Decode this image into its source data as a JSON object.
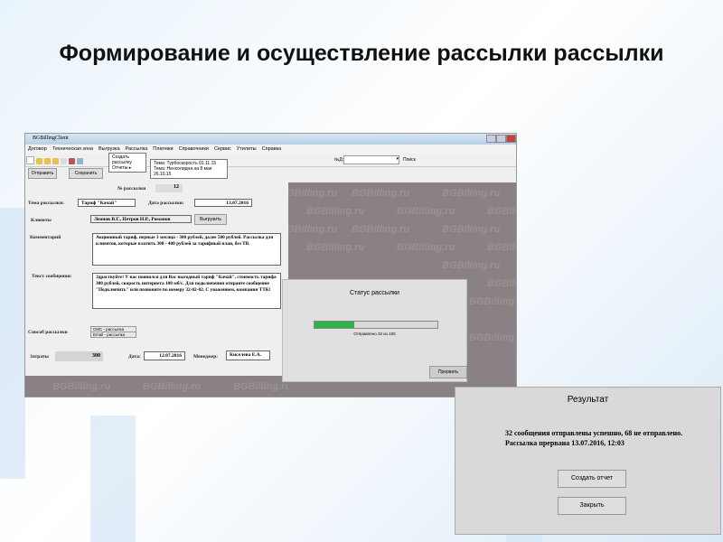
{
  "slide_title": "Формирование и осуществление рассылки рассылки",
  "window": {
    "title": "BGBillingClient",
    "menu": [
      "Договор",
      "Техническая зона",
      "Выгрузка",
      "Рассылка",
      "Платежи",
      "Справочники",
      "Сервис",
      "Утилиты",
      "Справка"
    ],
    "submenu": [
      "Создать рассылку",
      "Отчеты"
    ],
    "reports": [
      "Тема: Турбоскорость 01.11.15",
      "Тема: Ненсолидна на 8 мая 26.10.15"
    ],
    "nd_label": "№Д:",
    "search_label": "Поиск",
    "buttons": {
      "send": "Отправить",
      "save": "Сохранить",
      "export": "Выгрузить"
    }
  },
  "form": {
    "number_label": "№ рассылки",
    "number": "12",
    "subject_label": "Тема рассылки:",
    "subject": "Тариф \"Качай\"",
    "date_label": "Дата рассылки:",
    "date": "13.07.2016",
    "clients_label": "Клиенты",
    "clients": "Леонов В.Г., Петров Н.Р., Романов",
    "comment_label": "Комментарий",
    "comment": "Акционный тариф, первые 3 месяца - 300 рублей, далее 500 рублей. Рассылка для клиентов, которые платить 300 - 400 рублей за тарифный план, без ТВ.",
    "message_label": "Текст сообщения:",
    "message": "Здраствуйте! У нас появился для Вас выгодный тариф \"Качай\", стоимость тарифа 300 рублей, скорость интернета 100 мб/с. Для подключения отправте сообщение \"Подключить\" или позвоните по номеру 32-02-02. С уважением, компания ТТК!",
    "method_label": "Способ рассылки",
    "methods": [
      "СМС - рассылка",
      "Email - рассылка"
    ],
    "cost_label": "Затраты",
    "cost": "300",
    "date2_label": "Дата:",
    "date2": "12.07.2016",
    "manager_label": "Менеджер:",
    "manager": "Киселева Е.А."
  },
  "watermark": "BGBilling.ru",
  "status_dialog": {
    "title": "Статус рассылки",
    "progress_percent": 32,
    "progress_text": "Отправлено 32 из 100",
    "stop_button": "Прервать",
    "color": "#2db34a"
  },
  "result_dialog": {
    "title": "Результат",
    "message": "32 сообщения отправлены успешно, 68 не отправлено. Рассылка прервана 13.07.2016, 12:03",
    "report_button": "Создать отчет",
    "close_button": "Закрыть"
  }
}
